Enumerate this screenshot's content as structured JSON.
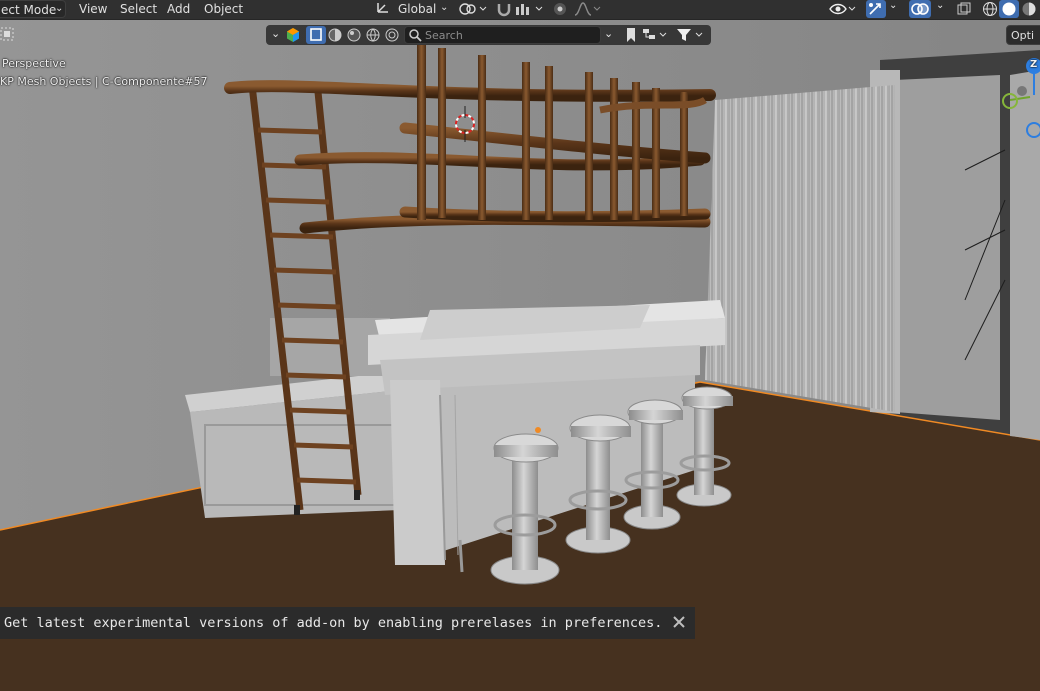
{
  "header": {
    "mode_label": "ect Mode",
    "menus": [
      "View",
      "Select",
      "Add",
      "Object"
    ],
    "orientation_label": "Global",
    "options_label": "Opti"
  },
  "viewport_overlay": {
    "view_name": "Perspective",
    "collection_info": "KP Mesh Objects | C-Componente#57"
  },
  "outliner_search": {
    "placeholder": "Search",
    "value": ""
  },
  "notification": {
    "message": "Get latest experimental versions of add-on by enabling prerelases in preferences."
  },
  "gizmo": {
    "z_axis_label": "Z"
  },
  "colors": {
    "accent": "#3f6db0",
    "selection_outline": "#f08a24",
    "floor": "#46311f",
    "wall": "#8a8a8a",
    "wood": "#6a4424"
  }
}
